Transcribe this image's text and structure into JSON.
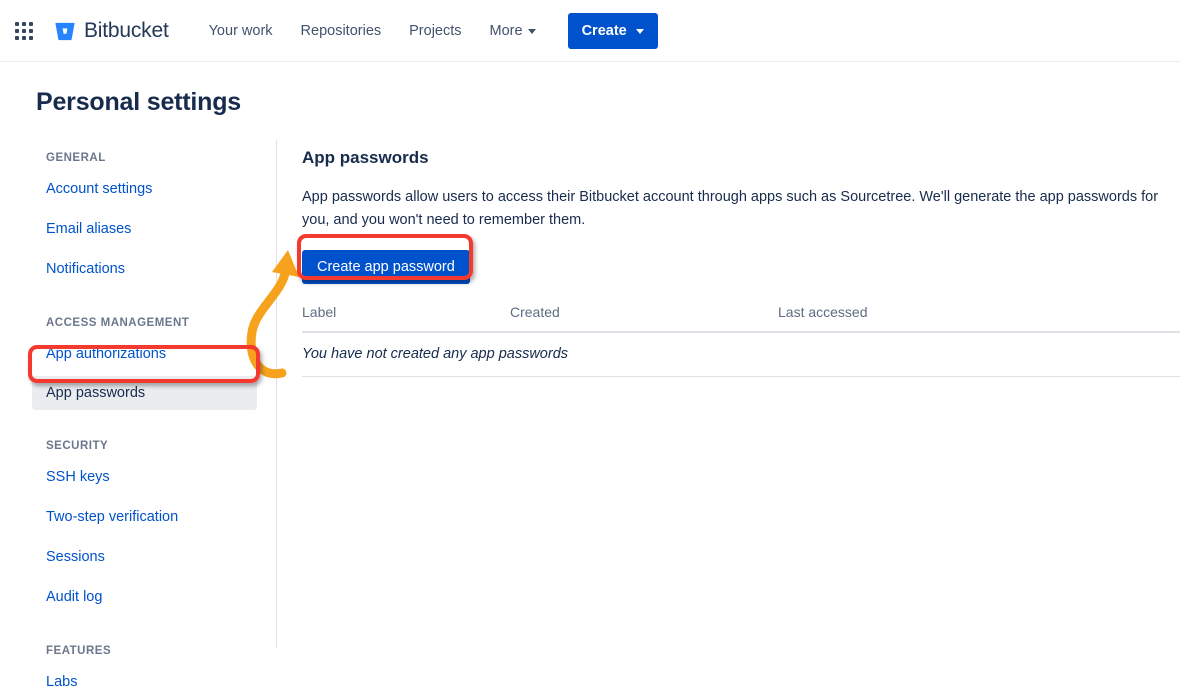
{
  "topnav": {
    "app_switcher_icon": "grid-apps-icon",
    "brand_icon": "bitbucket-logo-icon",
    "brand_name": "Bitbucket",
    "links": [
      {
        "label": "Your work",
        "has_chevron": false
      },
      {
        "label": "Repositories",
        "has_chevron": false
      },
      {
        "label": "Projects",
        "has_chevron": false
      },
      {
        "label": "More",
        "has_chevron": true
      }
    ],
    "create_label": "Create",
    "create_chevron_icon": "chevron-down-icon",
    "create_color": "#0052CC"
  },
  "page": {
    "title": "Personal settings"
  },
  "sidebar": {
    "groups": [
      {
        "heading": "GENERAL",
        "items": [
          {
            "label": "Account settings",
            "selected": false
          },
          {
            "label": "Email aliases",
            "selected": false
          },
          {
            "label": "Notifications",
            "selected": false
          }
        ]
      },
      {
        "heading": "ACCESS MANAGEMENT",
        "items": [
          {
            "label": "App authorizations",
            "selected": false
          },
          {
            "label": "App passwords",
            "selected": true
          }
        ]
      },
      {
        "heading": "SECURITY",
        "items": [
          {
            "label": "SSH keys",
            "selected": false
          },
          {
            "label": "Two-step verification",
            "selected": false
          },
          {
            "label": "Sessions",
            "selected": false
          },
          {
            "label": "Audit log",
            "selected": false
          }
        ]
      },
      {
        "heading": "FEATURES",
        "items": [
          {
            "label": "Labs",
            "selected": false
          }
        ]
      }
    ]
  },
  "main": {
    "heading": "App passwords",
    "description": "App passwords allow users to access their Bitbucket account through apps such as Sourcetree. We'll generate the app passwords for you, and you won't need to remember them.",
    "create_button_label": "Create app password",
    "table": {
      "columns": [
        "Label",
        "Created",
        "Last accessed"
      ],
      "empty_message": "You have not created any app passwords"
    }
  },
  "annotations": {
    "highlight_color": "#F4392F",
    "arrow_color": "#F6A21D",
    "arrow_icon": "curved-arrow-icon",
    "boxes": [
      {
        "target": "sidebar-item-app-passwords"
      },
      {
        "target": "create-app-password-button"
      }
    ]
  }
}
